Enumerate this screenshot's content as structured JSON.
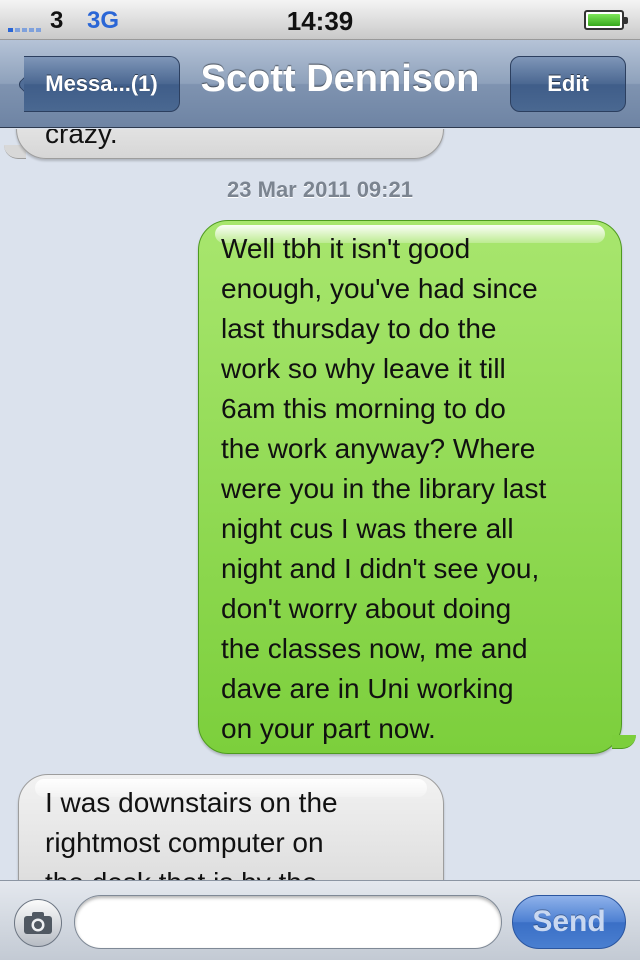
{
  "status_bar": {
    "carrier": "3",
    "network": "3G",
    "time": "14:39",
    "signal_bars": 5,
    "battery_level": 1.0,
    "signal_icon": "signal-bars-icon",
    "battery_icon": "battery-icon"
  },
  "nav": {
    "back_label": "Messa...(1)",
    "title": "Scott Dennison",
    "edit_label": "Edit"
  },
  "conversation": {
    "messages": [
      {
        "direction": "received",
        "text": "crazy."
      },
      {
        "direction": "timestamp",
        "text": "23 Mar 2011 09:21"
      },
      {
        "direction": "sent",
        "text": "Well tbh it isn't good\nenough, you've had since\nlast thursday to do the\nwork so why leave it till\n6am this morning to do\nthe work anyway? Where\nwere you in the library last\nnight cus I was there all\nnight and I didn't see you,\ndon't worry about doing\nthe classes now, me and\ndave are in Uni working\non your part now."
      },
      {
        "direction": "received",
        "text": " I was downstairs on the\nrightmost computer on\nthe desk that is by the"
      }
    ]
  },
  "input_bar": {
    "camera_icon": "camera-icon",
    "input_value": "",
    "input_placeholder": "",
    "send_label": "Send"
  },
  "colors": {
    "sent_bubble": "#7ccf3c",
    "received_bubble": "#d6d6d6",
    "background": "#dbe2ed",
    "nav_bar": "#8ea1bb",
    "send_button": "#4c7fd2"
  }
}
